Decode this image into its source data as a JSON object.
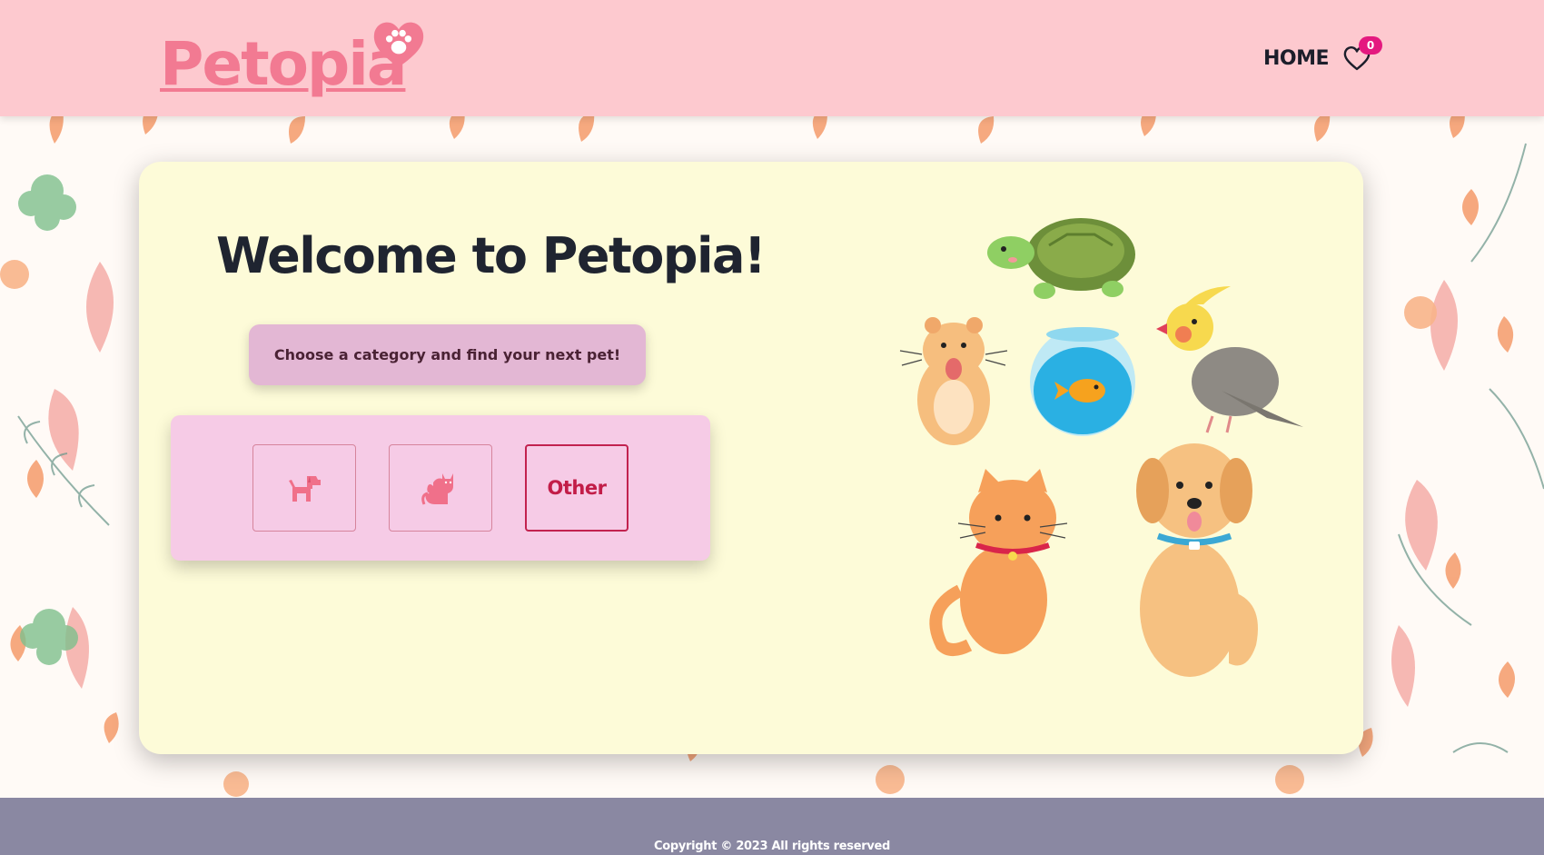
{
  "header": {
    "logo_text": "Petopia",
    "nav_home": "HOME",
    "favorites_count": "0",
    "favorites_icon": "heart-outline-icon",
    "logo_icon": "heart-paw-icon"
  },
  "main": {
    "welcome_title": "Welcome to Petopia!",
    "subtitle": "Choose a category and find your next pet!",
    "categories": [
      {
        "icon": "dog-icon",
        "label": ""
      },
      {
        "icon": "cat-icon",
        "label": ""
      },
      {
        "icon": "",
        "label": "Other"
      }
    ]
  },
  "footer": {
    "copyright": "Copyright © 2023 All rights reserved"
  },
  "colors": {
    "header_bg": "#fdc9cf",
    "logo": "#f27a92",
    "card_bg": "#fdfbd8",
    "subtitle_bg": "#e3b7d4",
    "panel_bg": "#f6cbe6",
    "accent": "#c21d48",
    "badge": "#e4197f",
    "footer_bg": "#8a88a2"
  }
}
